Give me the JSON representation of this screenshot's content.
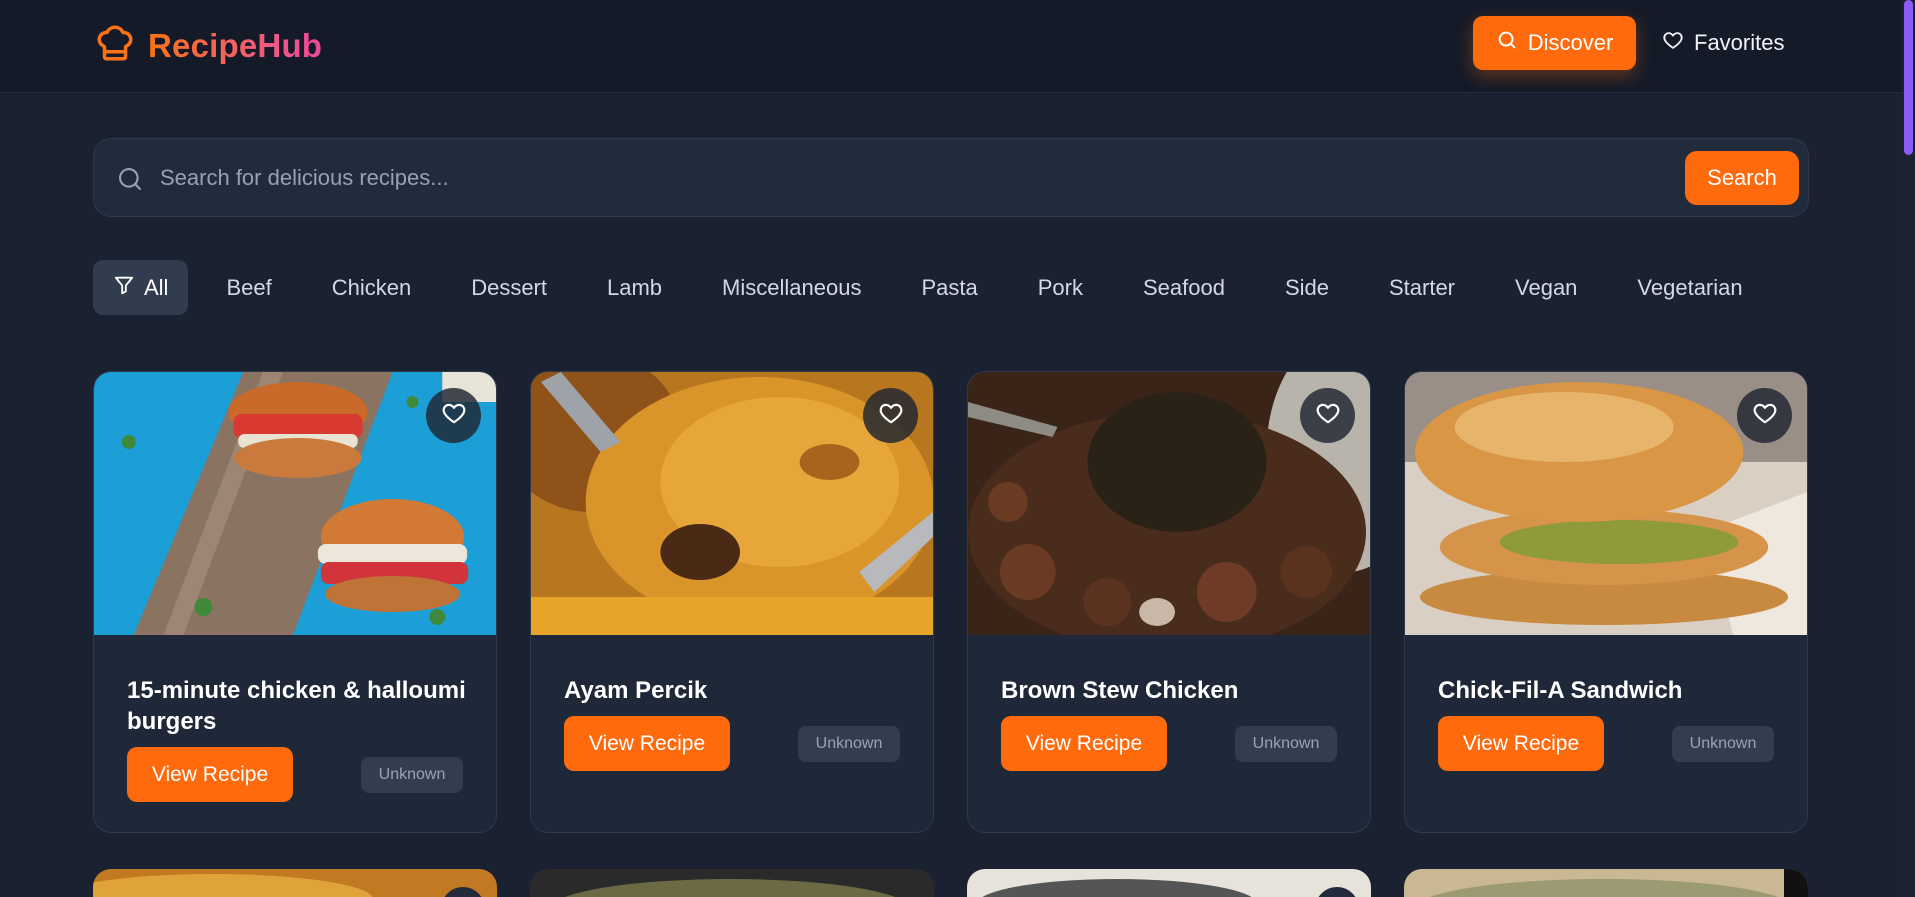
{
  "brand": {
    "name": "RecipeHub",
    "logo_icon": "chef-hat-icon",
    "accent": "#f97316"
  },
  "nav": {
    "discover_label": "Discover",
    "favorites_label": "Favorites"
  },
  "search": {
    "placeholder": "Search for delicious recipes...",
    "value": "",
    "button_label": "Search"
  },
  "categories": [
    {
      "label": "All",
      "active": true,
      "icon": "filter-icon"
    },
    {
      "label": "Beef"
    },
    {
      "label": "Chicken"
    },
    {
      "label": "Dessert"
    },
    {
      "label": "Lamb"
    },
    {
      "label": "Miscellaneous"
    },
    {
      "label": "Pasta"
    },
    {
      "label": "Pork"
    },
    {
      "label": "Seafood"
    },
    {
      "label": "Side"
    },
    {
      "label": "Starter"
    },
    {
      "label": "Vegan"
    },
    {
      "label": "Vegetarian"
    }
  ],
  "recipes": [
    {
      "title": "15-minute chicken & halloumi burgers",
      "button_label": "View Recipe",
      "badge": "Unknown"
    },
    {
      "title": "Ayam Percik",
      "button_label": "View Recipe",
      "badge": "Unknown"
    },
    {
      "title": "Brown Stew Chicken",
      "button_label": "View Recipe",
      "badge": "Unknown"
    },
    {
      "title": "Chick-Fil-A Sandwich",
      "button_label": "View Recipe",
      "badge": "Unknown"
    }
  ]
}
